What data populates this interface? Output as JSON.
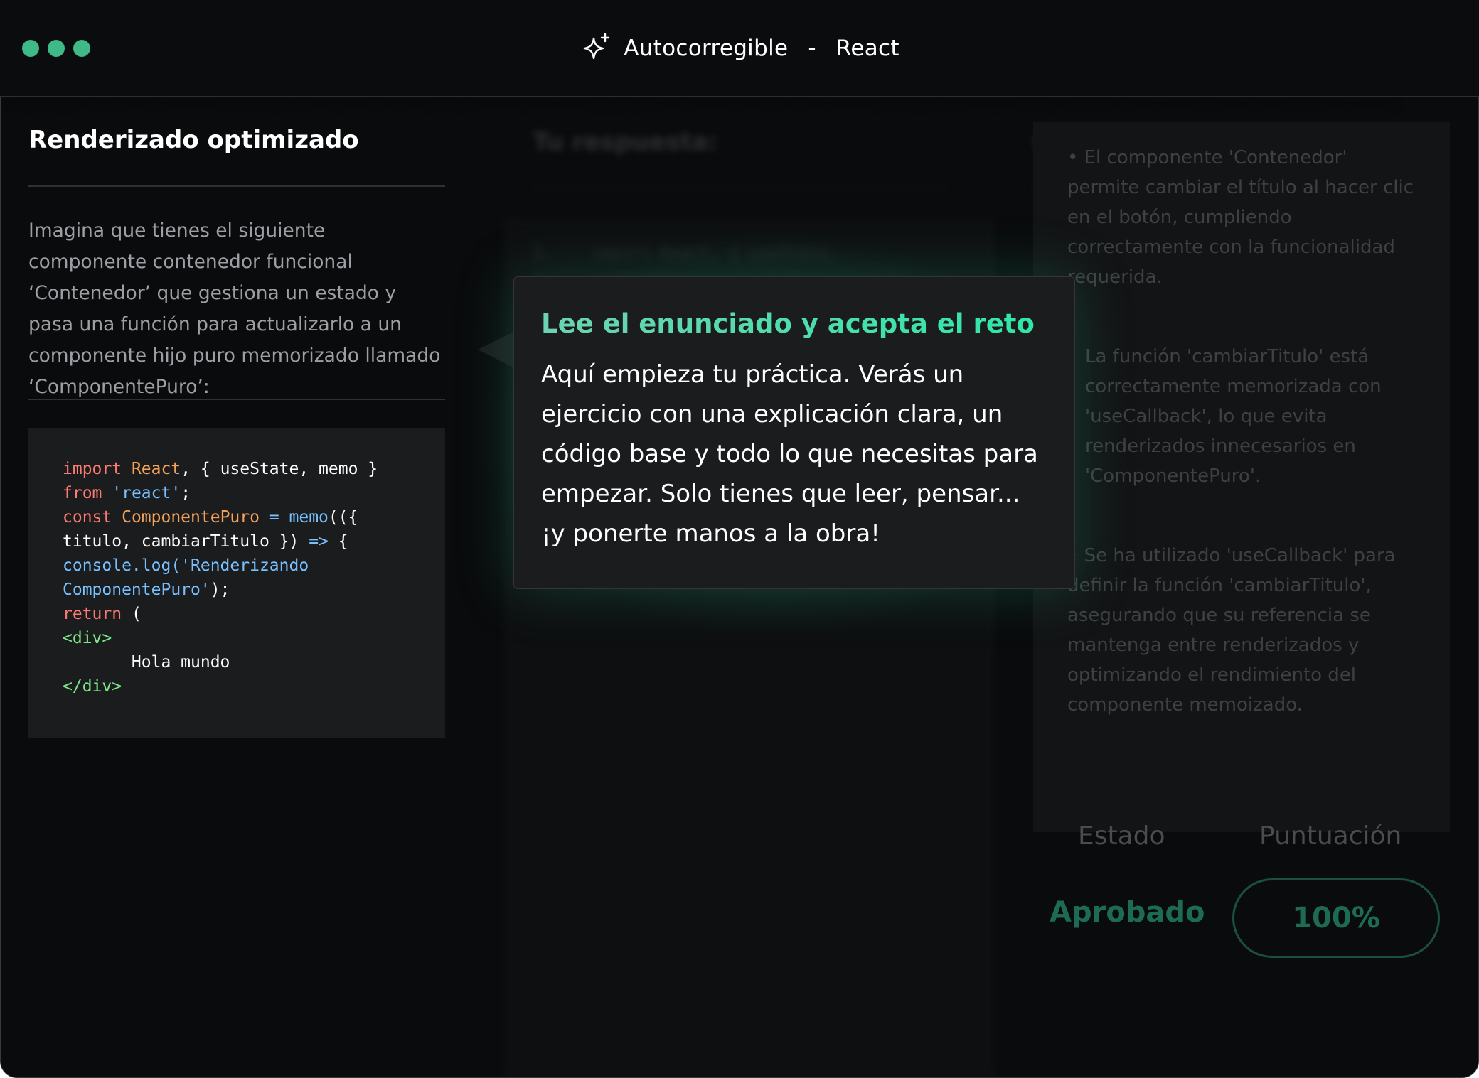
{
  "window": {
    "title": "Autocorregible",
    "separator": "-",
    "subtitle": "React",
    "title_icon": "sparkle-icon",
    "dot_color": "#3fb98a"
  },
  "exercise": {
    "title": "Renderizado optimizado",
    "description": "Imagina que tienes el siguiente componente contenedor funcional ‘Contenedor’ que gestiona un estado y pasa una función para actualizarlo a un componente hijo puro memorizado llamado ‘ComponentePuro’:"
  },
  "code_lines": [
    [
      {
        "t": "import ",
        "c": "kw"
      },
      {
        "t": "React",
        "c": "cl"
      },
      {
        "t": ", { useState, memo }",
        "c": ""
      }
    ],
    [
      {
        "t": "from ",
        "c": "kw"
      },
      {
        "t": "'react'",
        "c": "st"
      },
      {
        "t": ";",
        "c": ""
      }
    ],
    [
      {
        "t": "const ",
        "c": "kw"
      },
      {
        "t": "ComponentePuro",
        "c": "cl"
      },
      {
        "t": " = ",
        "c": "fn"
      },
      {
        "t": "memo",
        "c": "fn"
      },
      {
        "t": "(({",
        "c": ""
      }
    ],
    [
      {
        "t": "titulo, cambiarTitulo }) ",
        "c": ""
      },
      {
        "t": "=>",
        "c": "fn"
      },
      {
        "t": " {",
        "c": ""
      }
    ],
    [
      {
        "t": "console.log(",
        "c": "fn"
      },
      {
        "t": "'Renderizando",
        "c": "st"
      }
    ],
    [
      {
        "t": "ComponentePuro'",
        "c": "st"
      },
      {
        "t": ");",
        "c": ""
      }
    ],
    [
      {
        "t": "return",
        "c": "kw"
      },
      {
        "t": " (",
        "c": ""
      }
    ],
    [
      {
        "t": "<div>",
        "c": "tg"
      }
    ],
    [
      {
        "t": "       Hola mundo",
        "c": ""
      }
    ],
    [
      {
        "t": "</div>",
        "c": "tg"
      }
    ]
  ],
  "background": {
    "answer_heading": "Tu respuesta:",
    "correction_heading": "Corrección",
    "status_label": "Estado",
    "score_label": "Puntuación",
    "status_value": "Aprobado",
    "score_value": "100%"
  },
  "tooltip": {
    "title": "Lee el enunciado y acepta el reto",
    "body": "Aquí empieza tu práctica. Verás un ejercicio con una explicación clara, un código base y todo lo que necesitas para empezar. Solo tienes que leer, pensar... ¡y ponerte manos a la obra!"
  }
}
